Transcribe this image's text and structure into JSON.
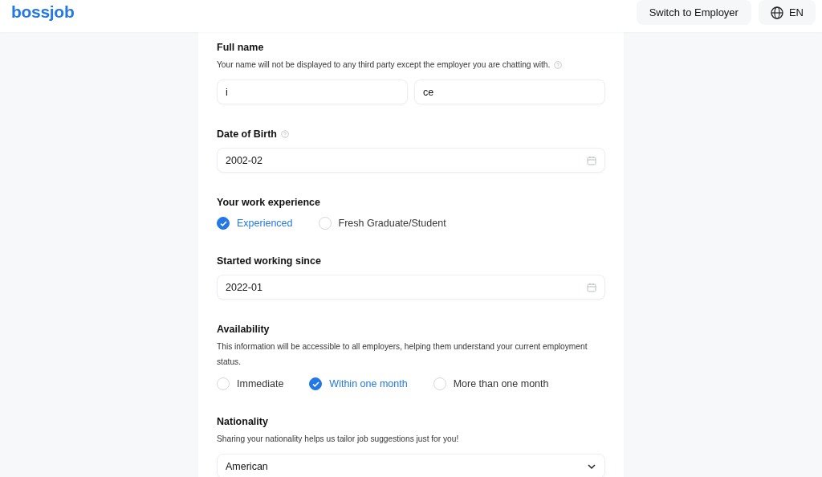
{
  "header": {
    "logo": "bossjob",
    "switch_button": "Switch to Employer",
    "language": "EN"
  },
  "sections": [
    {
      "kind": "name",
      "label": "Full name",
      "help": false,
      "hint": "Your name will not be displayed to any third party except the employer you are chatting with.",
      "hint_help": true,
      "values": [
        "i",
        "ce"
      ]
    },
    {
      "kind": "date",
      "label": "Date of Birth",
      "help": true,
      "value": "2002-02"
    },
    {
      "kind": "radio",
      "label": "Your work experience",
      "help": false,
      "options": [
        {
          "label": "Experienced",
          "selected": true
        },
        {
          "label": "Fresh Graduate/Student",
          "selected": false
        }
      ]
    },
    {
      "kind": "date",
      "label": "Started working since",
      "help": false,
      "value": "2022-01"
    },
    {
      "kind": "radio",
      "label": "Availability",
      "help": false,
      "hint": "This information will be accessible to all employers, helping them understand your current employment status.",
      "hint_help": false,
      "options": [
        {
          "label": "Immediate",
          "selected": false
        },
        {
          "label": "Within one month",
          "selected": true
        },
        {
          "label": "More than one month",
          "selected": false
        }
      ]
    },
    {
      "kind": "select",
      "label": "Nationality",
      "help": false,
      "hint": "Sharing your nationality helps us tailor job suggestions just for you!",
      "hint_help": false,
      "value": "American"
    }
  ]
}
